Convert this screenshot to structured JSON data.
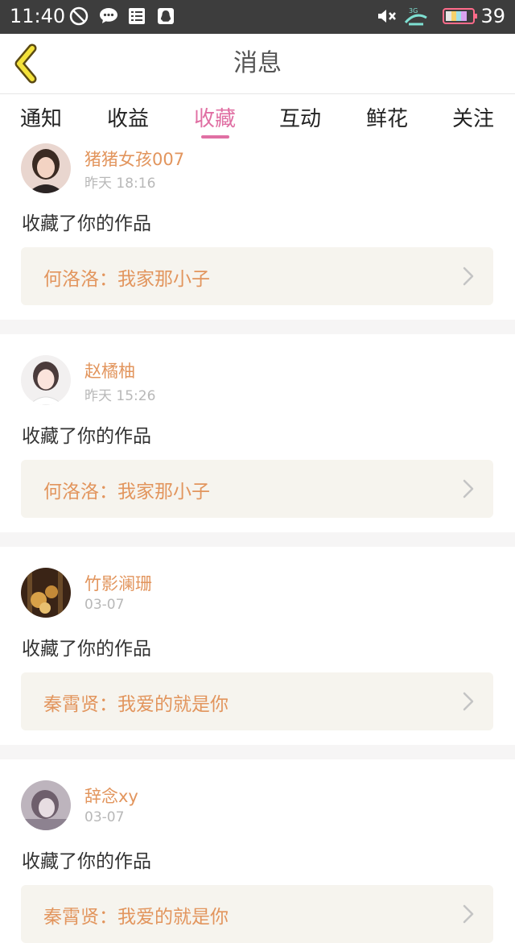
{
  "status_bar": {
    "time": "11:40",
    "battery_level": "39",
    "network": "3G",
    "icons": [
      "do-not-disturb-icon",
      "chat-bubble-icon",
      "list-icon",
      "penguin-icon",
      "mute-icon",
      "signal-icon",
      "battery-icon"
    ]
  },
  "header": {
    "title": "消息",
    "back_icon": "back-chevron-icon",
    "accent_color": "#e06fa3"
  },
  "tabs": [
    {
      "label": "通知",
      "active": false
    },
    {
      "label": "收益",
      "active": false
    },
    {
      "label": "收藏",
      "active": true
    },
    {
      "label": "互动",
      "active": false
    },
    {
      "label": "鲜花",
      "active": false
    },
    {
      "label": "关注",
      "active": false
    }
  ],
  "feed": [
    {
      "username": "猪猪女孩007",
      "time": "昨天 18:16",
      "action": "收藏了你的作品",
      "work": "何洛洛：我家那小子"
    },
    {
      "username": "赵橘柚",
      "time": "昨天 15:26",
      "action": "收藏了你的作品",
      "work": "何洛洛：我家那小子"
    },
    {
      "username": "竹影澜珊",
      "time": "03-07",
      "action": "收藏了你的作品",
      "work": "秦霄贤：我爱的就是你"
    },
    {
      "username": "辞念xy",
      "time": "03-07",
      "action": "收藏了你的作品",
      "work": "秦霄贤：我爱的就是你"
    }
  ],
  "colors": {
    "username": "#e2955d",
    "time": "#b8b8b8",
    "card_bg": "#f6f4ee",
    "separator": "#f6f5f5",
    "status_bar": "#3d3d3d"
  }
}
